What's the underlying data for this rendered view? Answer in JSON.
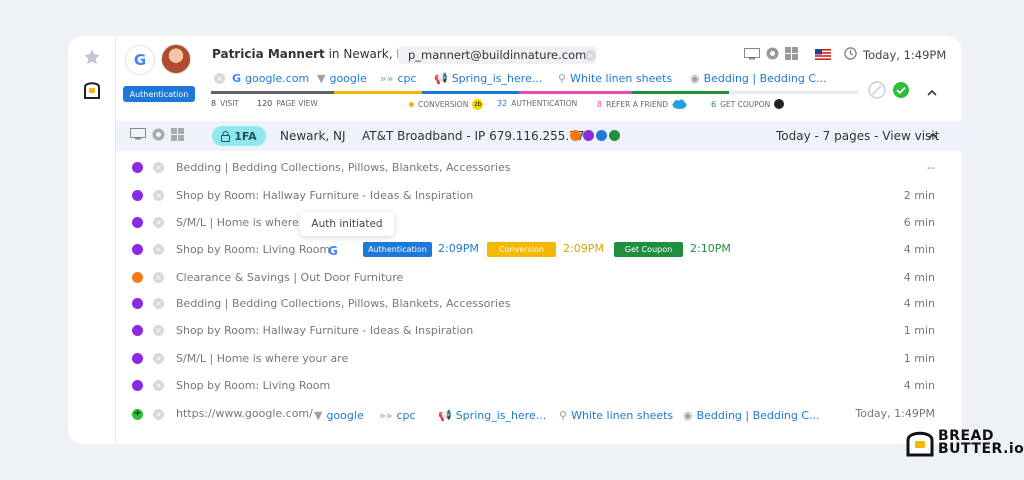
{
  "visitor": {
    "name": "Patricia Mannert",
    "location_prefix": "in Newark, NJ",
    "email": "p_mannert@buildinnature.com",
    "auth_badge": "Authentication",
    "login_glyph": "G",
    "timestamp": "Today, 1:49PM"
  },
  "source": {
    "site": "google.com",
    "filter": "google",
    "medium": "cpc",
    "campaign": "Spring_is_here...",
    "search": "White linen sheets",
    "content": "Bedding | Bedding C..."
  },
  "stats": {
    "visit_n": "8",
    "visit_label": "VISIT",
    "pageview_n": "120",
    "pageview_label": "PAGE VIEW",
    "conversion_label": "CONVERSION",
    "auth_n": "32",
    "auth_label": "AUTHENTICATION",
    "refer_n": "8",
    "refer_label": "REFER A FRIEND",
    "coupon_n": "6",
    "coupon_label": "GET COUPON",
    "progress": [
      {
        "fraction": 0.19,
        "color": "#5f6368"
      },
      {
        "fraction": 0.135,
        "color": "#f5b800"
      },
      {
        "fraction": 0.15,
        "color": "#1e78d7"
      },
      {
        "fraction": 0.175,
        "color": "#e64bb4"
      },
      {
        "fraction": 0.15,
        "color": "#1f8f3e"
      }
    ]
  },
  "visit": {
    "mfa": "1FA",
    "location": "Newark, NJ",
    "isp": "AT&T Broadband - IP 679.116.255.77",
    "dot_colors": [
      "#f27a1a",
      "#8a2be2",
      "#1e78d7",
      "#1f8f3e"
    ],
    "summary": "Today - 7 pages - View visit"
  },
  "pages": [
    {
      "title": "Bedding | Bedding Collections, Pillows, Blankets, Accessories",
      "time": "--",
      "color": "#8a2be2"
    },
    {
      "title": "Shop by Room: Hallway Furniture - Ideas & Inspiration",
      "time": "2 min",
      "color": "#8a2be2"
    },
    {
      "title": "S/M/L | Home is where y",
      "time": "6 min",
      "color": "#8a2be2"
    },
    {
      "title": "Shop by Room: Living Room",
      "time": "4 min",
      "color": "#8a2be2"
    },
    {
      "title": "Clearance & Savings | Out Door Furniture",
      "time": "4 min",
      "color": "#f27a1a"
    },
    {
      "title": "Bedding | Bedding Collections, Pillows, Blankets, Accessories",
      "time": "4 min",
      "color": "#8a2be2"
    },
    {
      "title": "Shop by Room: Hallway Furniture - Ideas & Inspiration",
      "time": "1 min",
      "color": "#8a2be2"
    },
    {
      "title": "S/M/L | Home is where your are",
      "time": "1 min",
      "color": "#8a2be2"
    },
    {
      "title": "Shop by Room: Living Room",
      "time": "4 min",
      "color": "#8a2be2"
    }
  ],
  "tooltip": "Auth initiated",
  "events": {
    "glyph": "G",
    "auth_label": "Authentication",
    "auth_time": "2:09PM",
    "conv_label": "Conversion",
    "conv_time": "2:09PM",
    "coupon_label": "Get Coupon",
    "coupon_time": "2:10PM"
  },
  "referrer": {
    "url": "https://www.google.com/",
    "filter": "google",
    "medium": "cpc",
    "campaign": "Spring_is_here...",
    "search": "White linen sheets",
    "content": "Bedding | Bedding C...",
    "time": "Today, 1:49PM"
  },
  "brand": {
    "line1": "BREAD",
    "line2": "BUTTER.io"
  },
  "colors": {
    "accent": "#1e78d7",
    "conversion": "#f5b800",
    "coupon": "#1f8f3e",
    "success": "#2bbf3a"
  }
}
